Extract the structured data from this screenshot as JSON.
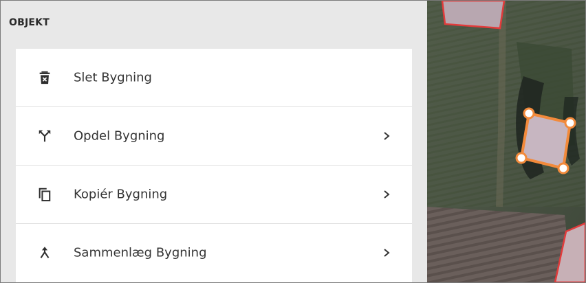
{
  "panel": {
    "title": "OBJEKT"
  },
  "menu": {
    "items": [
      {
        "label": "Slet Bygning",
        "icon": "trash-icon",
        "has_submenu": false
      },
      {
        "label": "Opdel Bygning",
        "icon": "split-icon",
        "has_submenu": true
      },
      {
        "label": "Kopiér Bygning",
        "icon": "copy-icon",
        "has_submenu": true
      },
      {
        "label": "Sammenlæg Bygning",
        "icon": "merge-icon",
        "has_submenu": true
      }
    ]
  },
  "colors": {
    "selection_accent": "#f28a3b",
    "building_outline": "#e23b3b",
    "text": "#333333"
  }
}
